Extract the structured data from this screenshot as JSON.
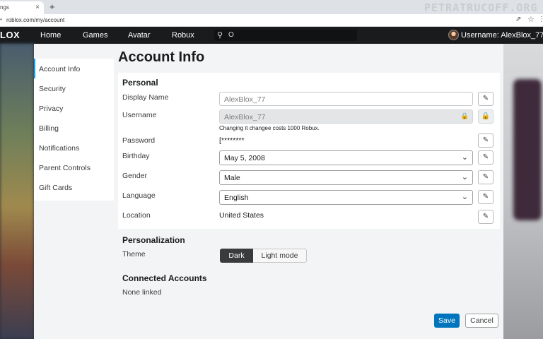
{
  "browser": {
    "tab_title": "ngs",
    "tab_close": "×",
    "new_tab": "+",
    "url": "roblox.com/my/account",
    "watermark": "PETRATRUCOFF.ORG"
  },
  "topnav": {
    "logo": "LOX",
    "items": [
      "Home",
      "Games",
      "Avatar",
      "Robux"
    ],
    "search_value": "O",
    "user_label": "Username:  AlexBlox_77"
  },
  "sidebar": {
    "items": [
      {
        "label": "Account Info"
      },
      {
        "label": "Security"
      },
      {
        "label": "Privacy"
      },
      {
        "label": "Billing"
      },
      {
        "label": "Notifications"
      },
      {
        "label": "Parent Controls"
      },
      {
        "label": "Gift Cards"
      }
    ],
    "active": "Account Info"
  },
  "main": {
    "title": "Account Info",
    "personal": {
      "title": "Personal",
      "display_name": {
        "label": "Display Name",
        "value": "AlexBlox_77"
      },
      "username": {
        "label": "Username",
        "value": "AlexBlox_77",
        "hint": "Changing it changee costs 1000 Robux."
      },
      "password": {
        "label": "Password",
        "value": "[********"
      },
      "birthday": {
        "label": "Birthday",
        "value": "May 5, 2008"
      },
      "gender": {
        "label": "Gender",
        "value": "Male"
      },
      "language": {
        "label": "Language",
        "value": "English"
      },
      "location": {
        "label": "Location",
        "value": "United States"
      }
    },
    "personalization": {
      "title": "Personalization",
      "theme_label": "Theme",
      "theme_options": [
        "Dark",
        "Light mode"
      ],
      "theme_selected": "Dark"
    },
    "connected": {
      "title": "Connected Accounts",
      "value": "None linked"
    },
    "actions": {
      "save": "Save",
      "cancel": "Cancel"
    }
  },
  "colors": {
    "accent": "#0074bd",
    "active_indicator": "#00a2ff",
    "nav_bg": "#191b1d"
  },
  "icons": {
    "edit": "pencil-icon",
    "lock": "lock-icon",
    "dropdown": "chevron-down-icon",
    "search": "search-icon"
  }
}
